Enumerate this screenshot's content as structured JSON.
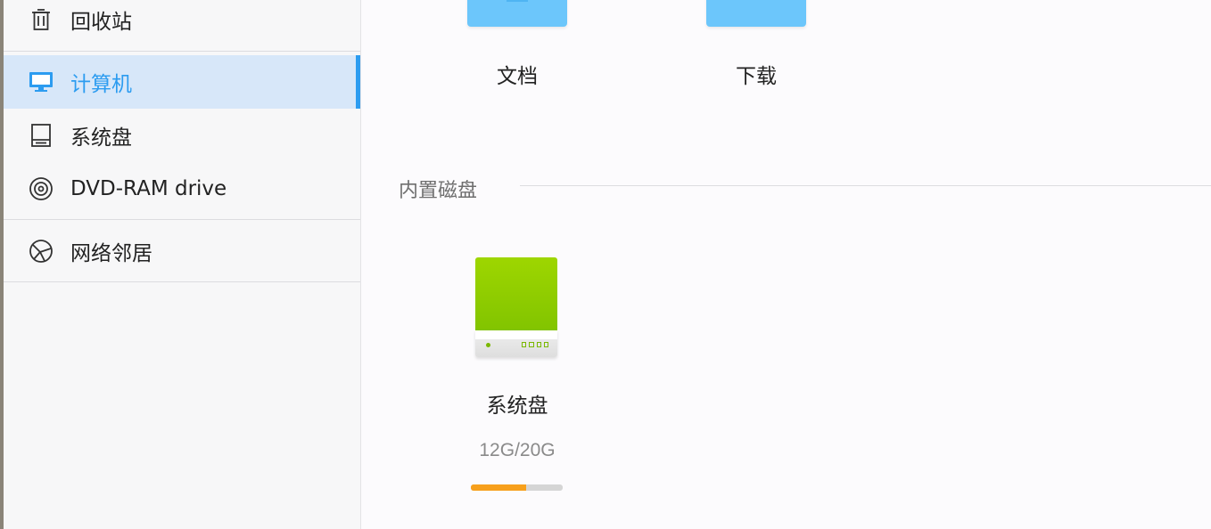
{
  "sidebar": {
    "items": [
      {
        "label": "回收站",
        "icon": "trash-icon"
      },
      {
        "label": "计算机",
        "icon": "computer-icon",
        "active": true
      },
      {
        "label": "系统盘",
        "icon": "disk-icon"
      },
      {
        "label": "DVD-RAM drive",
        "icon": "disc-icon"
      },
      {
        "label": "网络邻居",
        "icon": "network-icon"
      }
    ]
  },
  "main": {
    "folders": [
      {
        "label": "文档",
        "icon": "documents-folder-icon"
      },
      {
        "label": "下载",
        "icon": "downloads-folder-icon"
      }
    ],
    "section_title": "内置磁盘",
    "disks": [
      {
        "name": "系统盘",
        "usage": "12G/20G",
        "used_fraction": 0.6
      }
    ]
  },
  "colors": {
    "accent": "#2c9cf0",
    "folder": "#6cc6fb",
    "disk_green": "#8fcd00",
    "progress_fill": "#f7a01c"
  }
}
